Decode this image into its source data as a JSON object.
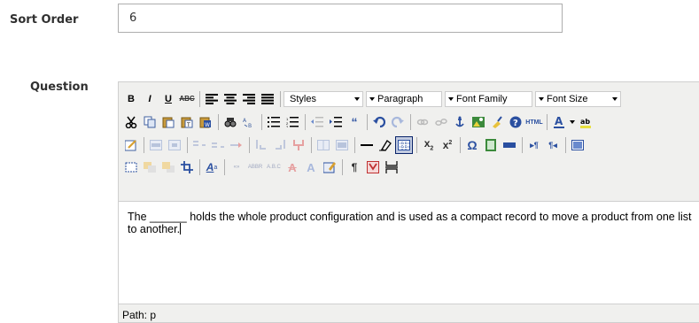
{
  "form": {
    "sort_order": {
      "label": "Sort Order",
      "value": "6"
    },
    "question": {
      "label": "Question"
    }
  },
  "editor": {
    "toolbar": {
      "styles": "Styles",
      "format": "Paragraph",
      "font_family": "Font Family",
      "font_size": "Font Size"
    },
    "content": "The ______ holds the whole product configuration and is used as a compact record to move a product from one list to another.",
    "status_path": "Path: p"
  },
  "colors": {
    "accent": "#0a246a",
    "toolbar_bg": "#f0f0ee",
    "border": "#adadad"
  }
}
